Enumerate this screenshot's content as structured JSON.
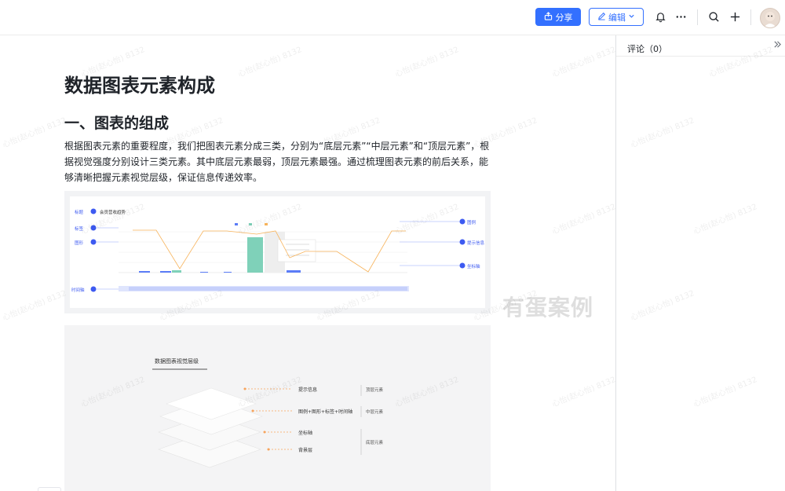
{
  "toolbar": {
    "share_label": "分享",
    "edit_label": "编辑"
  },
  "document": {
    "title": "数据图表元素构成",
    "heading": "一、图表的组成",
    "paragraph": "根据图表元素的重要程度，我们把图表元素分成三类，分别为“底层元素”“中层元素”和“顶层元素”，根据视觉强度分别设计三类元素。其中底层元素最弱，顶层元素最强。通过梳理图表元素的前后关系，能够清晰把握元素视觉层级，保证信息传递效率。"
  },
  "figure1": {
    "chart_title": "会员营收趋势",
    "left_labels": [
      "标题",
      "标签",
      "图形",
      "时间轴"
    ],
    "right_labels": [
      "图例",
      "提示信息",
      "坐标轴"
    ]
  },
  "figure2": {
    "title": "数据图表视觉层级",
    "layers": [
      "提示信息",
      "图例+图形+标签+时间轴",
      "坐标轴",
      "背景层"
    ],
    "groups": [
      "顶层元素",
      "中层元素",
      "底层元素"
    ]
  },
  "overlay_text": "有蛋案例",
  "watermark": "心怡(赵心怡) 8132",
  "comments": {
    "title": "评论（0）"
  },
  "colors": {
    "accent": "#3370ff",
    "chart_green": "#7fd1b9",
    "chart_orange": "#f7b35b",
    "chart_blue": "#5b7cf7"
  }
}
